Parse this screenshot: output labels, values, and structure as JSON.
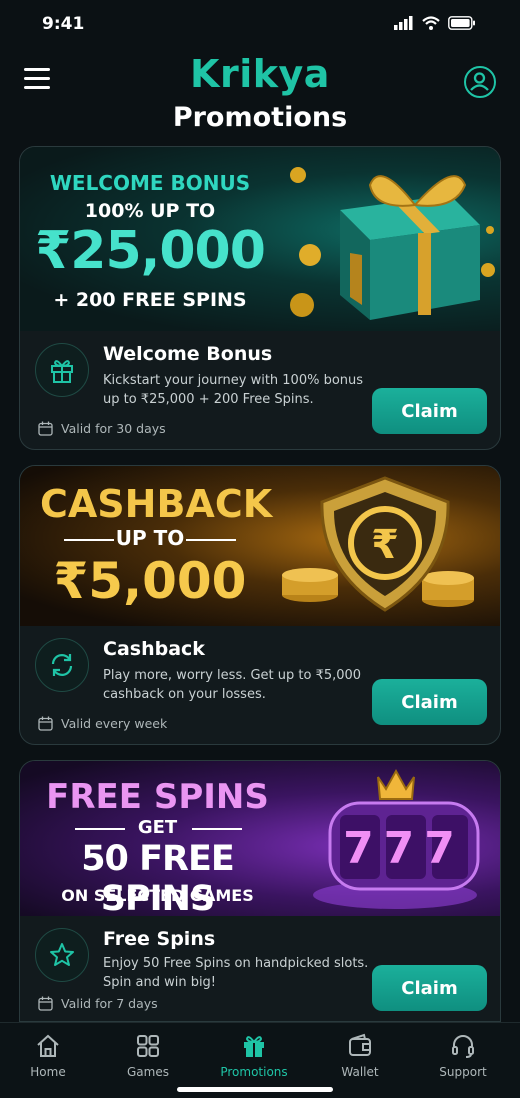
{
  "status": {
    "time": "9:41"
  },
  "header": {
    "brand": "Krikya",
    "title": "Promotions"
  },
  "promos": [
    {
      "banner": {
        "line1": "WELCOME BONUS",
        "line2": "100% UP TO",
        "line3": "₹25,000",
        "line4": "+ 200 FREE SPINS"
      },
      "title": "Welcome Bonus",
      "description": "Kickstart your journey with 100% bonus up to ₹25,000 + 200 Free Spins.",
      "validity": "Valid for 30 days",
      "claim_label": "Claim",
      "icon": "gift-icon"
    },
    {
      "banner": {
        "line1": "CASHBACK",
        "line2": "UP TO",
        "line3": "₹5,000"
      },
      "title": "Cashback",
      "description": "Play more, worry less. Get up to ₹5,000 cashback on your losses.",
      "validity": "Valid every week",
      "claim_label": "Claim",
      "icon": "refresh-icon"
    },
    {
      "banner": {
        "line1": "FREE SPINS",
        "line2": "GET",
        "line3": "50 FREE SPINS",
        "line4": "ON SELECTED GAMES",
        "slot": "777"
      },
      "title": "Free Spins",
      "description": "Enjoy 50 Free Spins on handpicked slots. Spin and win big!",
      "validity": "Valid for 7 days",
      "claim_label": "Claim",
      "icon": "star-icon"
    }
  ],
  "tabs": [
    {
      "label": "Home",
      "icon": "home-icon",
      "active": false
    },
    {
      "label": "Games",
      "icon": "grid-icon",
      "active": false
    },
    {
      "label": "Promotions",
      "icon": "gift-icon",
      "active": true
    },
    {
      "label": "Wallet",
      "icon": "wallet-icon",
      "active": false
    },
    {
      "label": "Support",
      "icon": "headset-icon",
      "active": false
    }
  ],
  "colors": {
    "accent": "#1fc4a6",
    "background": "#0b1114",
    "card": "#121a1d",
    "gold": "#f0b93a",
    "purple": "#e58cf0"
  }
}
